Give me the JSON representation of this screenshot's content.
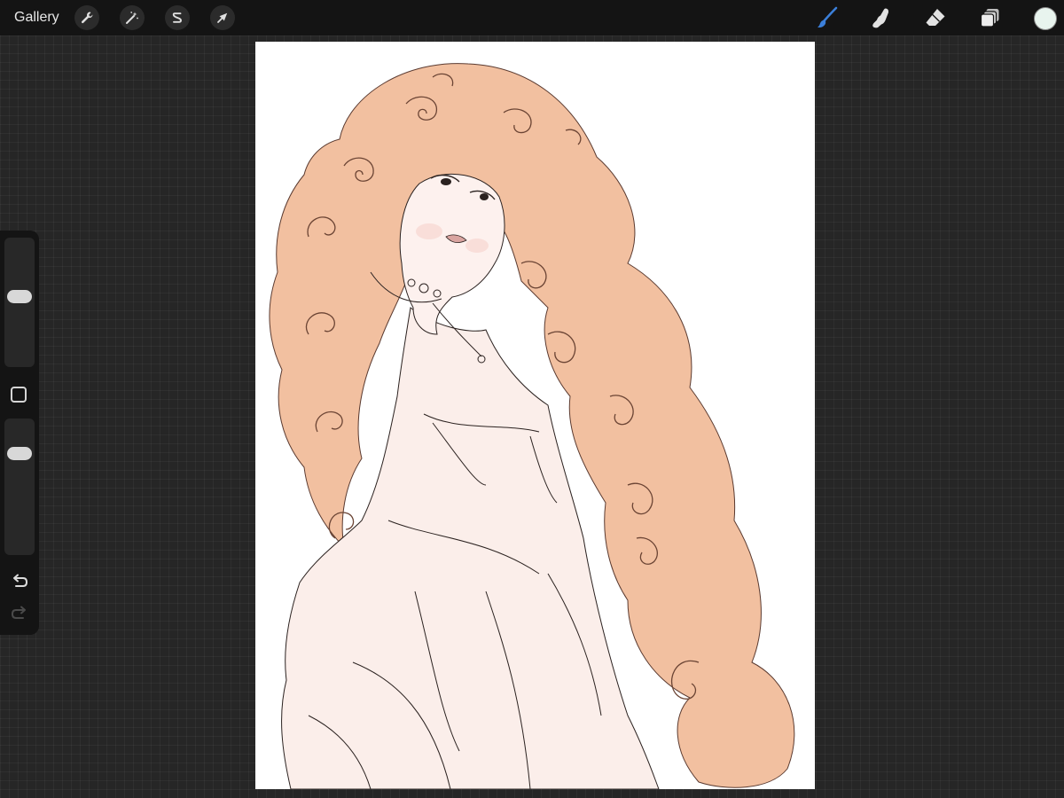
{
  "topbar": {
    "gallery_label": "Gallery",
    "actions": [
      {
        "name": "actions-wrench-icon"
      },
      {
        "name": "adjustments-wand-icon"
      },
      {
        "name": "selection-icon"
      },
      {
        "name": "transform-arrow-icon"
      }
    ],
    "tools": [
      {
        "name": "brush-icon",
        "active": true
      },
      {
        "name": "smudge-icon",
        "active": false
      },
      {
        "name": "eraser-icon",
        "active": false
      },
      {
        "name": "layers-icon",
        "active": false
      }
    ],
    "current_color": "#e8f4ee"
  },
  "sidebar": {
    "brush_size_level": 0.55,
    "opacity_level": 0.78
  },
  "colors": {
    "toolbar_bg": "#141414",
    "canvas_bg": "#ffffff",
    "active_tool": "#3b7fd9",
    "hair": "#f2c0a0",
    "dress": "#fbeeea",
    "lineart": "#2b2220"
  }
}
